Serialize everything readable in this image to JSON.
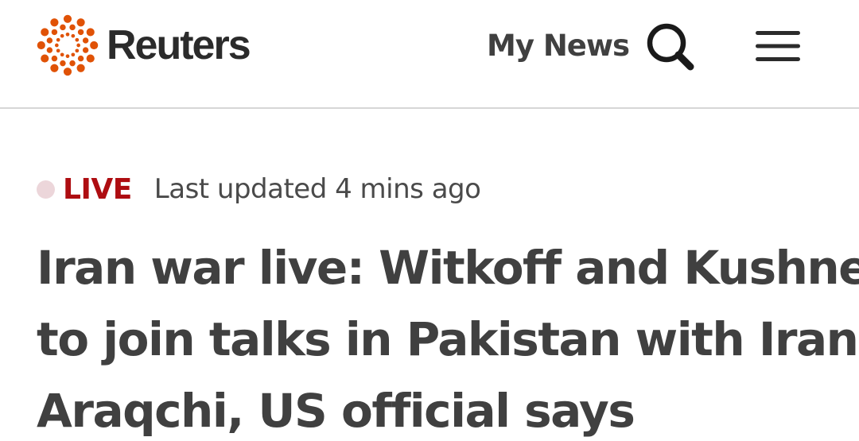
{
  "header": {
    "logo_text": "Reuters",
    "my_news_label": "My News",
    "search_icon": "search-icon",
    "menu_icon": "hamburger-menu-icon",
    "brand_color": "#e05206"
  },
  "article": {
    "live_label": "LIVE",
    "live_color": "#ae0d11",
    "last_updated": "Last updated 4 mins ago",
    "headline_lines": [
      "Iran war live: Witkoff and Kushner",
      "to join talks in Pakistan with Iran's",
      "Araqchi, US official says"
    ]
  }
}
